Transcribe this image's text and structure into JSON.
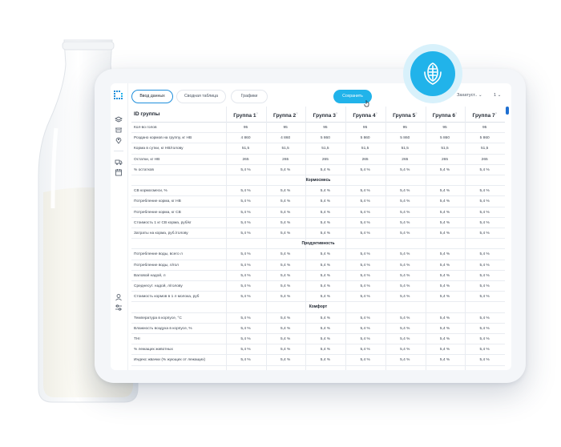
{
  "toolbar": {
    "tabs": [
      "Ввод данных",
      "Сводная таблица",
      "Графики"
    ],
    "save_label": "Сохранить",
    "right_dropdown": "Захатуст..",
    "page": "1"
  },
  "table": {
    "header_label": "ID группы",
    "groups": [
      "Группа 1",
      "Группа 2",
      "Группа 3",
      "Группа 4",
      "Группа 5",
      "Группа 6",
      "Группа 7"
    ],
    "help_mark": "?",
    "rows": [
      {
        "type": "data",
        "label": "Кол-во голов",
        "values": [
          "95",
          "95",
          "95",
          "95",
          "95",
          "95",
          "95"
        ]
      },
      {
        "type": "data",
        "label": "Роздано кормов на группу, кг НВ",
        "values": [
          "4 860",
          "4 860",
          "5 860",
          "5 860",
          "5 860",
          "5 860",
          "5 860"
        ]
      },
      {
        "type": "data",
        "label": "Корма в сутки, кг НВ/голову",
        "values": [
          "51,5",
          "51,5",
          "51,5",
          "51,5",
          "51,5",
          "51,5",
          "51,5"
        ]
      },
      {
        "type": "data",
        "label": "Остатки, кг НВ",
        "values": [
          "265",
          "265",
          "265",
          "265",
          "265",
          "265",
          "265"
        ]
      },
      {
        "type": "data",
        "label": "% остатков",
        "values": [
          "5,4 %",
          "5,4 %",
          "5,4 %",
          "5,4 %",
          "5,4 %",
          "5,4 %",
          "5,4 %"
        ]
      },
      {
        "type": "section",
        "label": "Кормосмесь"
      },
      {
        "type": "data",
        "label": "СВ кормосмеси, %",
        "values": [
          "5,4 %",
          "5,4 %",
          "5,4 %",
          "5,4 %",
          "5,4 %",
          "5,4 %",
          "5,4 %"
        ]
      },
      {
        "type": "data",
        "label": "Потребление корма, кг НВ",
        "values": [
          "5,4 %",
          "5,4 %",
          "5,4 %",
          "5,4 %",
          "5,4 %",
          "5,4 %",
          "5,4 %"
        ]
      },
      {
        "type": "data",
        "label": "Потребление корма, кг СВ",
        "values": [
          "5,4 %",
          "5,4 %",
          "5,4 %",
          "5,4 %",
          "5,4 %",
          "5,4 %",
          "5,4 %"
        ]
      },
      {
        "type": "data",
        "label": "Стоимость 1 кг СВ корма, руб/кг",
        "values": [
          "5,4 %",
          "5,4 %",
          "5,4 %",
          "5,4 %",
          "5,4 %",
          "5,4 %",
          "5,4 %"
        ]
      },
      {
        "type": "data",
        "label": "Затраты на корма, руб./голову",
        "values": [
          "5,4 %",
          "5,4 %",
          "5,4 %",
          "5,4 %",
          "5,4 %",
          "5,4 %",
          "5,4 %"
        ]
      },
      {
        "type": "section",
        "label": "Продуктивность"
      },
      {
        "type": "data",
        "label": "Потребление воды, всего л",
        "values": [
          "5,4 %",
          "5,4 %",
          "5,4 %",
          "5,4 %",
          "5,4 %",
          "5,4 %",
          "5,4 %"
        ]
      },
      {
        "type": "data",
        "label": "Потребление воды, л/гол",
        "values": [
          "5,4 %",
          "5,4 %",
          "5,4 %",
          "5,4 %",
          "5,4 %",
          "5,4 %",
          "5,4 %"
        ]
      },
      {
        "type": "data",
        "label": "Валовой надой, л",
        "values": [
          "5,4 %",
          "5,4 %",
          "5,4 %",
          "5,4 %",
          "5,4 %",
          "5,4 %",
          "5,4 %"
        ]
      },
      {
        "type": "data",
        "label": "Среднесут. надой, л/голову",
        "values": [
          "5,4 %",
          "5,4 %",
          "5,4 %",
          "5,4 %",
          "5,4 %",
          "5,4 %",
          "5,4 %"
        ]
      },
      {
        "type": "data",
        "label": "Стоимость кормов в 1 л молока, руб",
        "values": [
          "5,4 %",
          "5,4 %",
          "5,4 %",
          "5,4 %",
          "5,4 %",
          "5,4 %",
          "5,4 %"
        ]
      },
      {
        "type": "section",
        "label": "Комфорт"
      },
      {
        "type": "data",
        "label": "Температура в корпусе, °С",
        "values": [
          "5,4 %",
          "5,4 %",
          "5,4 %",
          "5,4 %",
          "5,4 %",
          "5,4 %",
          "5,4 %"
        ]
      },
      {
        "type": "data",
        "label": "Влажность воздуха в корпусе, %",
        "values": [
          "5,4 %",
          "5,4 %",
          "5,4 %",
          "5,4 %",
          "5,4 %",
          "5,4 %",
          "5,4 %"
        ]
      },
      {
        "type": "data",
        "label": "THI",
        "values": [
          "5,4 %",
          "5,4 %",
          "5,4 %",
          "5,4 %",
          "5,4 %",
          "5,4 %",
          "5,4 %"
        ]
      },
      {
        "type": "data",
        "label": "% лежащих животных",
        "values": [
          "5,4 %",
          "5,4 %",
          "5,4 %",
          "5,4 %",
          "5,4 %",
          "5,4 %",
          "5,4 %"
        ]
      },
      {
        "type": "data",
        "label": "Индекс жвачки (% жующих от лежащих)",
        "values": [
          "5,4 %",
          "5,4 %",
          "5,4 %",
          "5,4 %",
          "5,4 %",
          "5,4 %",
          "5,4 %"
        ]
      }
    ]
  },
  "icons": {
    "logo": "grid-logo-icon",
    "sidebar": [
      "layers-icon",
      "feed-icon",
      "location-icon",
      "truck-icon",
      "calendar-icon",
      "user-icon",
      "settings-icon"
    ],
    "badge": "corn-icon",
    "cursor": "hand-cursor-icon"
  },
  "colors": {
    "accent": "#21b3ea",
    "active_border": "#1f8fdc",
    "scrollbar": "#1f6fd1"
  }
}
